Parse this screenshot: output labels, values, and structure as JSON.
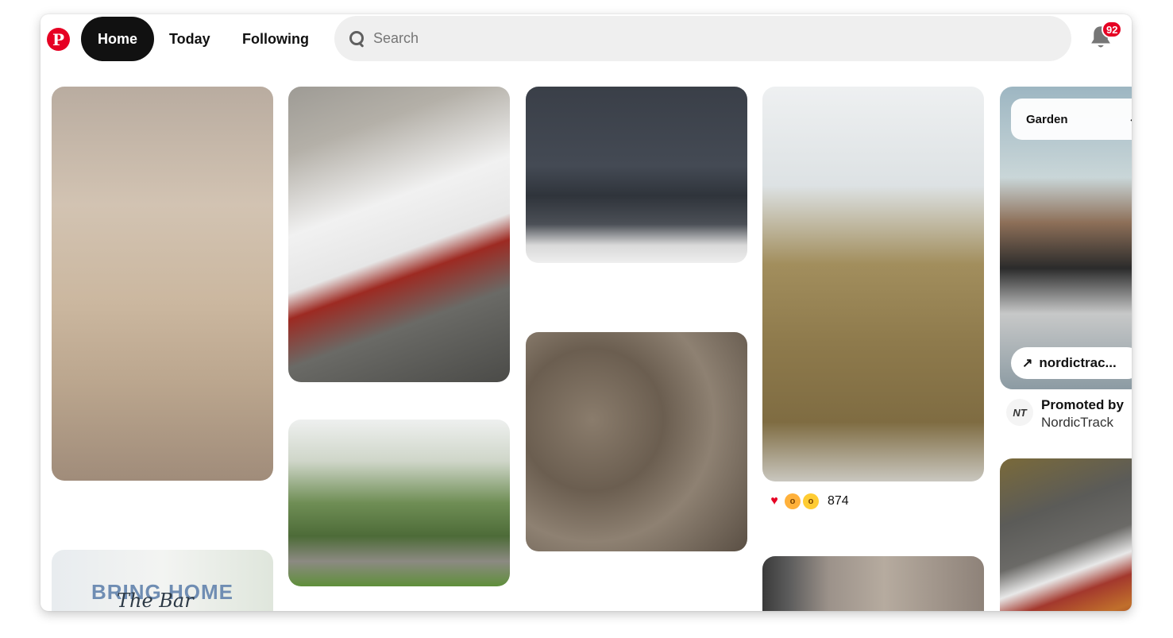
{
  "nav": {
    "logo_letter": "P",
    "home": "Home",
    "today": "Today",
    "following": "Following"
  },
  "search": {
    "placeholder": "Search"
  },
  "notifications": {
    "count": "92"
  },
  "pins": {
    "bring_home": {
      "line1": "BRING HOME",
      "line2": "The Bar"
    },
    "hair": {
      "reaction_count": "874"
    },
    "promo": {
      "board": "Garden",
      "visit_label": "nordictrac...",
      "promoted_by": "Promoted by",
      "advertiser": "NordicTrack"
    }
  },
  "colors": {
    "brand": "#e60023",
    "active_tab_bg": "#111111",
    "search_bg": "#efefef"
  },
  "icons": [
    "pinterest-logo-icon",
    "search-icon",
    "bell-icon",
    "chevron-down-icon",
    "arrow-up-right-icon",
    "heart-reaction-icon",
    "wow-reaction-icon"
  ]
}
